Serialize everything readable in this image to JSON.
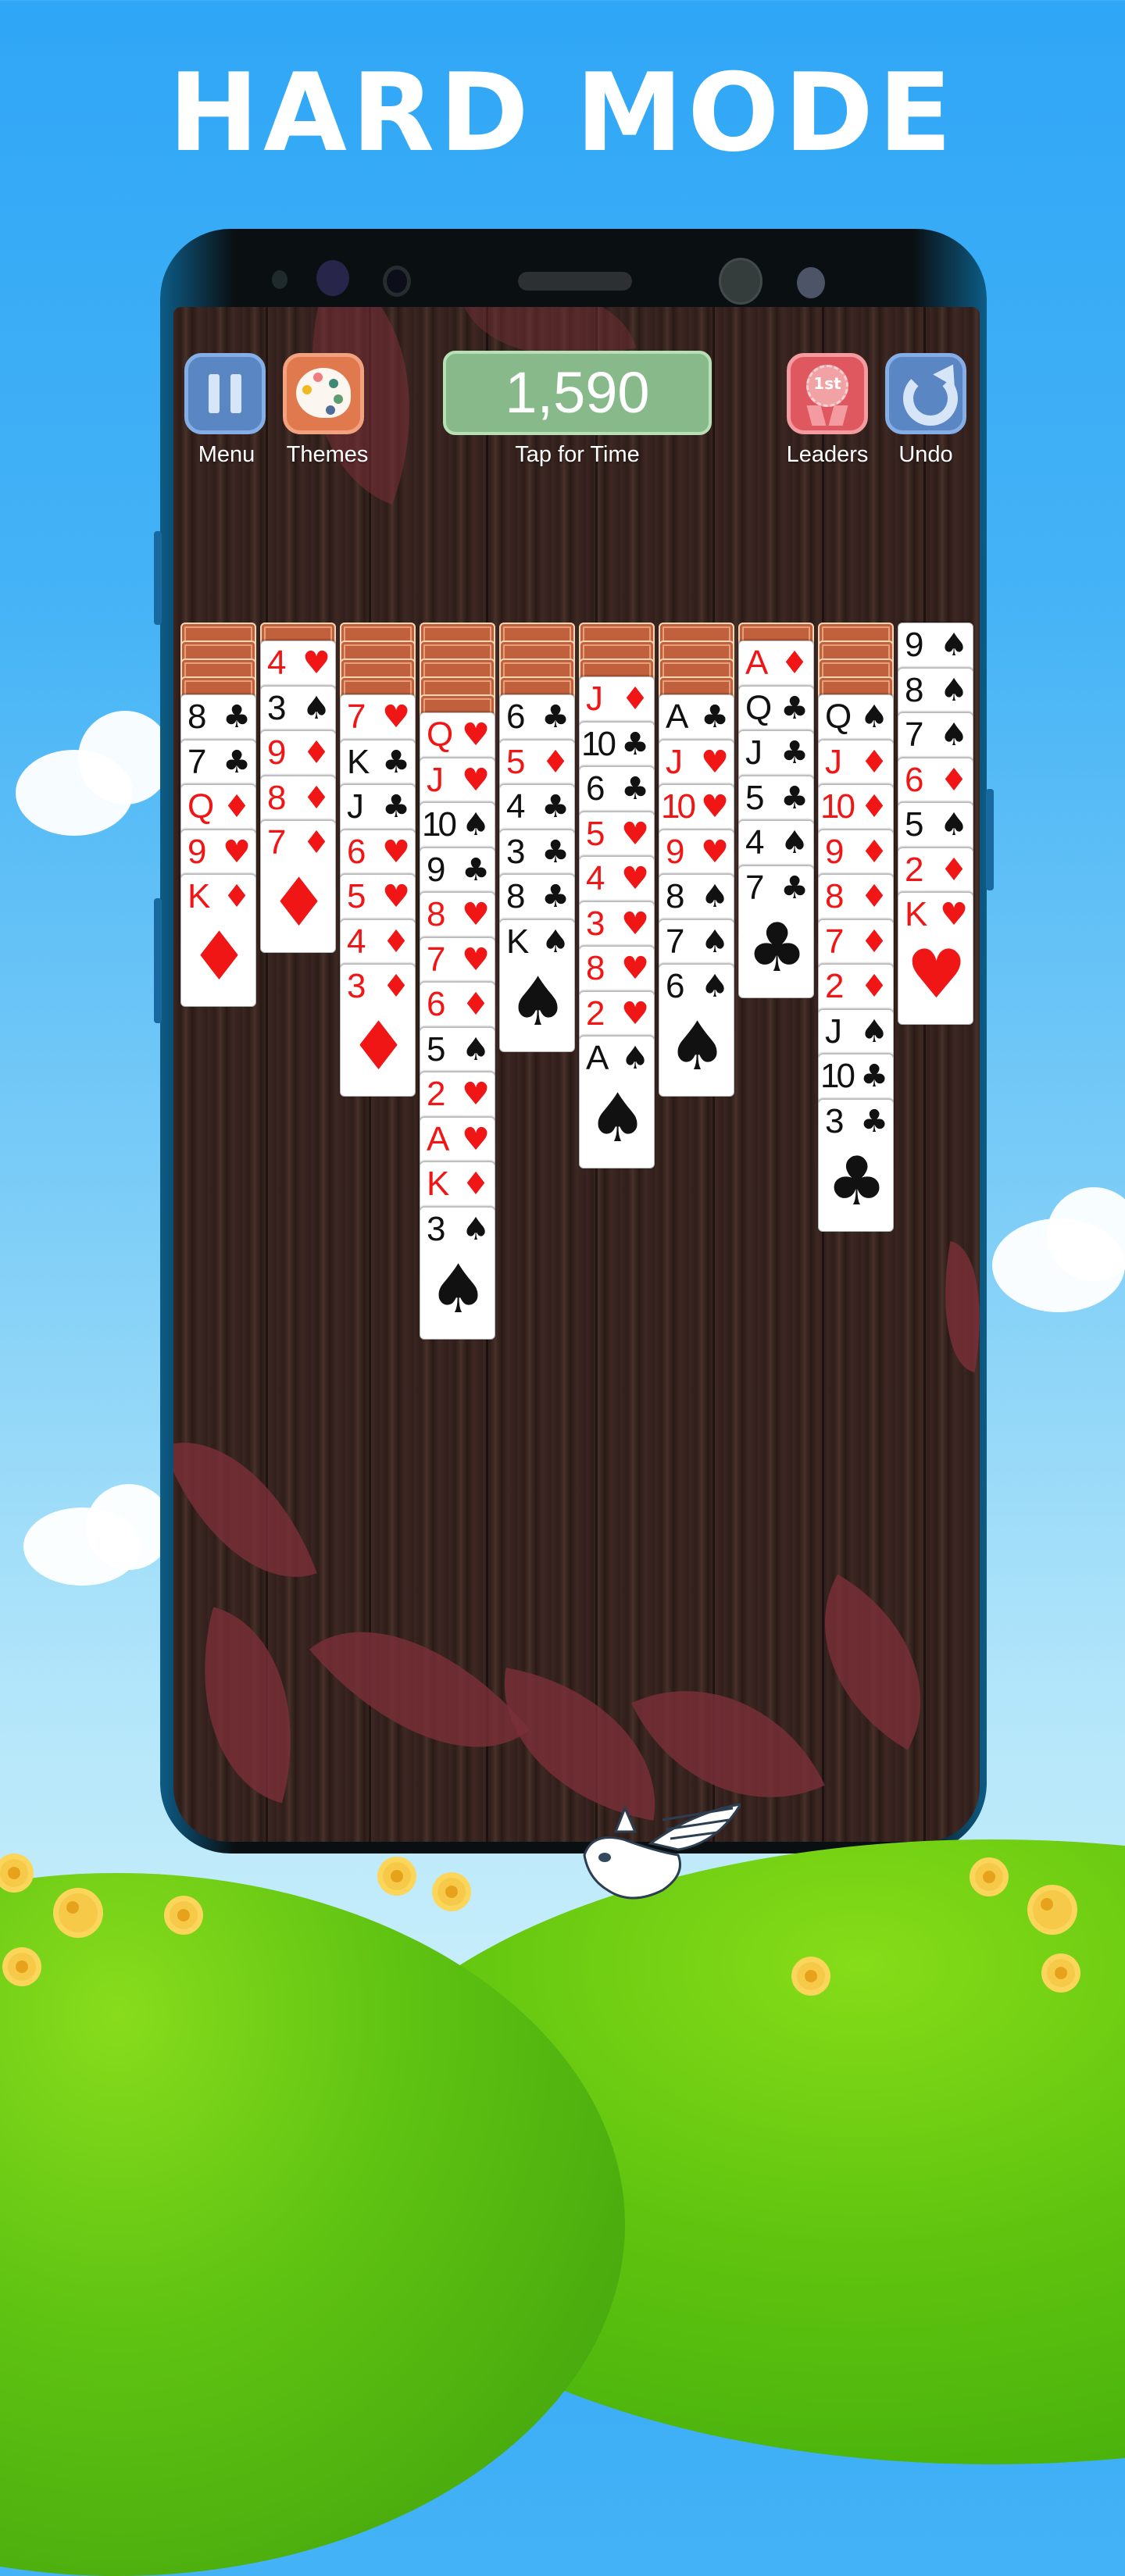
{
  "promo": {
    "headline": "HARD MODE"
  },
  "hud": {
    "menu": {
      "label": "Menu",
      "icon": "pause-icon",
      "color": "#5b86c4"
    },
    "themes": {
      "label": "Themes",
      "icon": "palette-icon",
      "color": "#e07a4e"
    },
    "score": {
      "value": "1,590",
      "caption": "Tap for Time",
      "color": "#87b98a"
    },
    "leaders": {
      "label": "Leaders",
      "icon": "first-place-ribbon-icon",
      "badge": "1st",
      "color": "#e0585f"
    },
    "undo": {
      "label": "Undo",
      "icon": "undo-arrow-icon",
      "color": "#5b86c4"
    }
  },
  "tableau": [
    {
      "hidden": 4,
      "cards": [
        "8♣",
        "7♣",
        "Q♦",
        "9♥",
        "K♦"
      ]
    },
    {
      "hidden": 1,
      "cards": [
        "4♥",
        "3♠",
        "9♦",
        "8♦",
        "7♦"
      ]
    },
    {
      "hidden": 4,
      "cards": [
        "7♥",
        "K♣",
        "J♣",
        "6♥",
        "5♥",
        "4♦",
        "3♦"
      ]
    },
    {
      "hidden": 5,
      "cards": [
        "Q♥",
        "J♥",
        "10♠",
        "9♣",
        "8♥",
        "7♥",
        "6♦",
        "5♠",
        "2♥",
        "A♥",
        "K♦",
        "3♠"
      ]
    },
    {
      "hidden": 4,
      "cards": [
        "6♣",
        "5♦",
        "4♣",
        "3♣",
        "8♣",
        "K♠"
      ]
    },
    {
      "hidden": 3,
      "cards": [
        "J♦",
        "10♣",
        "6♣",
        "5♥",
        "4♥",
        "3♥",
        "8♥",
        "2♥",
        "A♠"
      ]
    },
    {
      "hidden": 4,
      "cards": [
        "A♣",
        "J♥",
        "10♥",
        "9♥",
        "8♠",
        "7♠",
        "6♠"
      ]
    },
    {
      "hidden": 1,
      "cards": [
        "A♦",
        "Q♣",
        "J♣",
        "5♣",
        "4♠",
        "7♣"
      ]
    },
    {
      "hidden": 4,
      "cards": [
        "Q♠",
        "J♦",
        "10♦",
        "9♦",
        "8♦",
        "7♦",
        "2♦",
        "J♠",
        "10♣",
        "3♣"
      ]
    },
    {
      "hidden": 0,
      "cards": [
        "9♠",
        "8♠",
        "7♠",
        "6♦",
        "5♠",
        "2♦",
        "K♥"
      ]
    }
  ],
  "colors": {
    "red_suit": "#f01616",
    "black_suit": "#111111",
    "card_back": "#c0603c",
    "sky": "#2fa6f6",
    "grass": "#5cc21a"
  }
}
